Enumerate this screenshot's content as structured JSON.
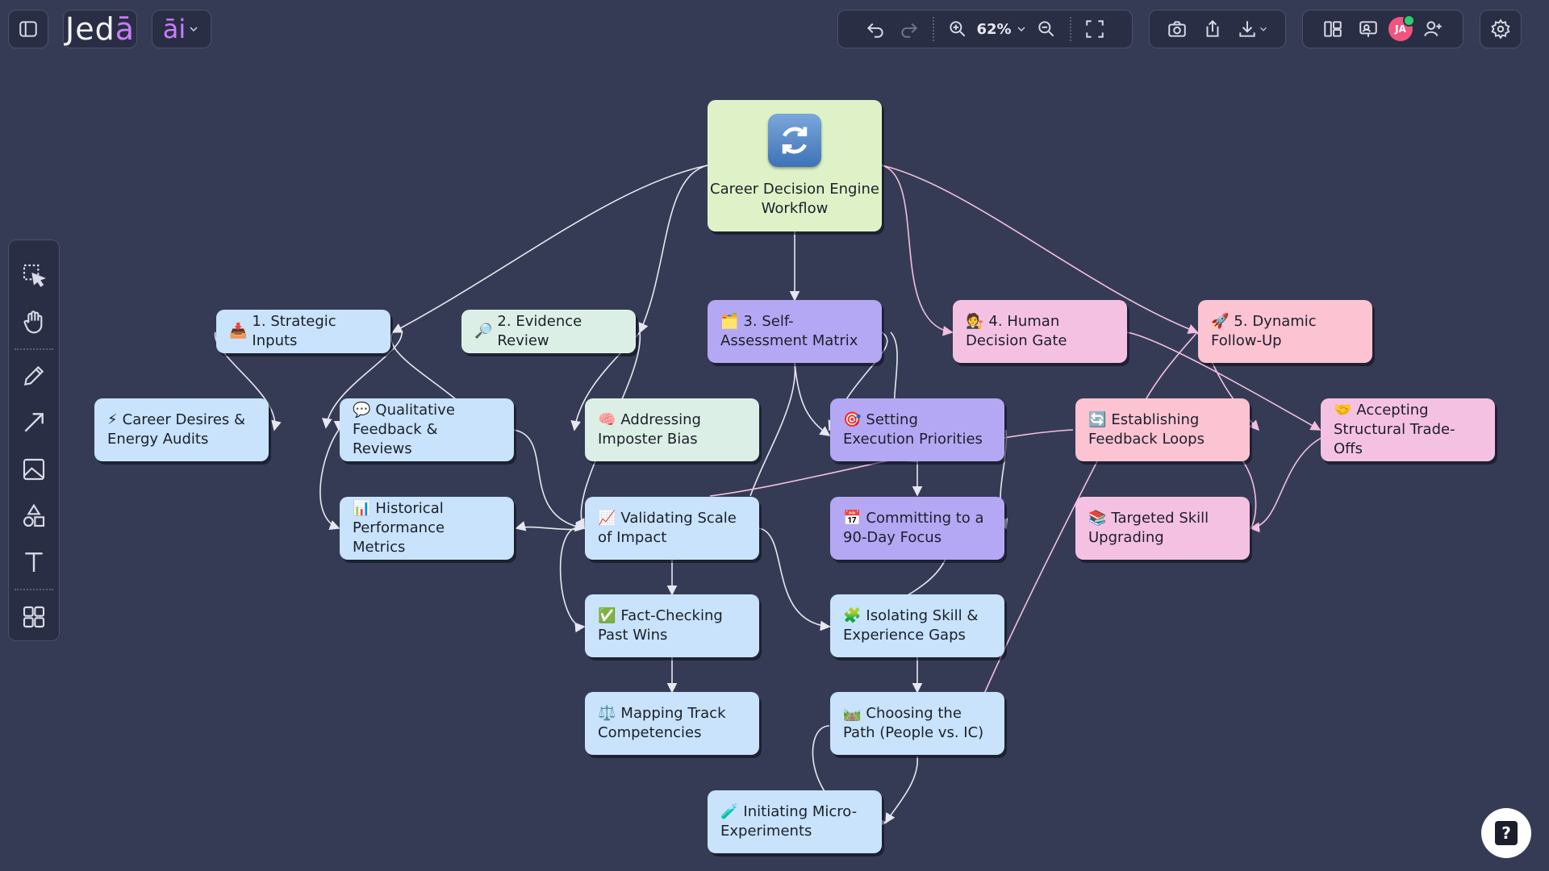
{
  "app": {
    "brand_name": "Jedā",
    "ai_label": "āi"
  },
  "toolbar": {
    "zoom_level": "62%",
    "avatar_initials": "JA"
  },
  "diagram": {
    "root": {
      "icon": "🔄",
      "label": "Career Decision Engine Workflow"
    },
    "nodes": {
      "strategic_inputs": {
        "emoji": "📥",
        "label": "1. Strategic Inputs"
      },
      "evidence_review": {
        "emoji": "🔎",
        "label": "2. Evidence Review"
      },
      "self_assessment": {
        "emoji": "🗂️",
        "label": "3. Self-Assessment Matrix"
      },
      "human_gate": {
        "emoji": "🧑‍⚖️",
        "label": "4. Human Decision Gate"
      },
      "dynamic_followup": {
        "emoji": "🚀",
        "label": "5. Dynamic Follow-Up"
      },
      "career_desires": {
        "emoji": "⚡",
        "label": "Career Desires & Energy Audits"
      },
      "qualitative_feedback": {
        "emoji": "💬",
        "label": "Qualitative Feedback & Reviews"
      },
      "historical_metrics": {
        "emoji": "📊",
        "label": "Historical Performance Metrics"
      },
      "imposter_bias": {
        "emoji": "🧠",
        "label": "Addressing Imposter Bias"
      },
      "validating_scale": {
        "emoji": "📈",
        "label": "Validating Scale of Impact"
      },
      "fact_checking": {
        "emoji": "✅",
        "label": "Fact-Checking Past Wins"
      },
      "mapping_track": {
        "emoji": "⚖️",
        "label": "Mapping Track Competencies"
      },
      "execution_priorities": {
        "emoji": "🎯",
        "label": "Setting Execution Priorities"
      },
      "committing_90": {
        "emoji": "📅",
        "label": "Committing to a 90-Day Focus"
      },
      "isolating_gaps": {
        "emoji": "🧩",
        "label": "Isolating Skill & Experience Gaps"
      },
      "choosing_path": {
        "emoji": "🛤️",
        "label": "Choosing the Path (People vs. IC)"
      },
      "micro_experiments": {
        "emoji": "🧪",
        "label": "Initiating Micro-Experiments"
      },
      "feedback_loops": {
        "emoji": "🔄",
        "label": "Establishing Feedback Loops"
      },
      "skill_upgrading": {
        "emoji": "📚",
        "label": "Targeted Skill Upgrading"
      },
      "structural_tradeoffs": {
        "emoji": "🤝",
        "label": "Accepting Structural Trade-Offs"
      }
    }
  },
  "colors": {
    "canvas": "#363b55",
    "root": "#dff2c7",
    "blue_node": "#c8e3fb",
    "mint_node": "#dcefe6",
    "purple_node": "#b4a8f4",
    "pink_node": "#f5c1e3",
    "rose_node": "#fcc3d3",
    "edge": "#e6e7f2",
    "edge_pink": "#f1bfe0"
  },
  "icons": {
    "toolbar": [
      "sidebar-toggle-icon",
      "undo-icon",
      "redo-icon",
      "zoom-in-icon",
      "chevron-down-icon",
      "zoom-out-icon",
      "fit-screen-icon",
      "camera-icon",
      "share-upload-icon",
      "download-icon",
      "layout-icon",
      "presentation-icon",
      "add-user-icon",
      "settings-icon"
    ],
    "tools": [
      "select-icon",
      "hand-icon",
      "pencil-icon",
      "arrow-icon",
      "image-icon",
      "shapes-icon",
      "text-icon",
      "grid-icon"
    ],
    "help": "help-icon"
  }
}
